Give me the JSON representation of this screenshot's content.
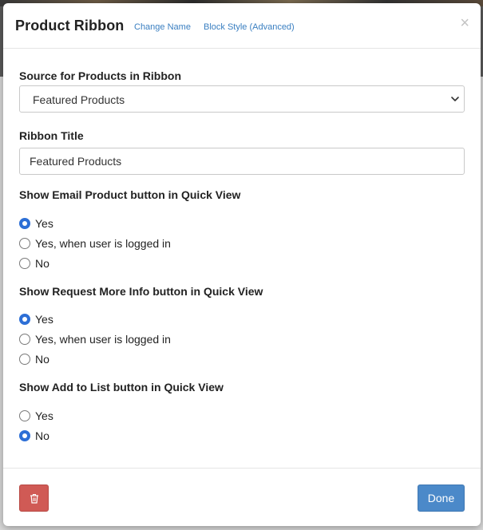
{
  "modal": {
    "title": "Product Ribbon",
    "change_name_link": "Change Name",
    "block_style_link": "Block Style (Advanced)",
    "close_glyph": "×"
  },
  "source_field": {
    "label": "Source for Products in Ribbon",
    "selected": "Featured Products"
  },
  "ribbon_title_field": {
    "label": "Ribbon Title",
    "value": "Featured Products"
  },
  "email_group": {
    "label": "Show Email Product button in Quick View",
    "options": [
      "Yes",
      "Yes, when user is logged in",
      "No"
    ],
    "selected": "Yes"
  },
  "info_group": {
    "label": "Show Request More Info button in Quick View",
    "options": [
      "Yes",
      "Yes, when user is logged in",
      "No"
    ],
    "selected": "Yes"
  },
  "list_group": {
    "label": "Show Add to List button in Quick View",
    "options": [
      "Yes",
      "No"
    ],
    "selected": "No"
  },
  "footer": {
    "done_label": "Done",
    "delete_icon": "trash-icon"
  },
  "colors": {
    "accent": "#2d6fd6",
    "link": "#3a7fc1",
    "done_button": "#4b89c9",
    "delete_button": "#d05a55"
  }
}
